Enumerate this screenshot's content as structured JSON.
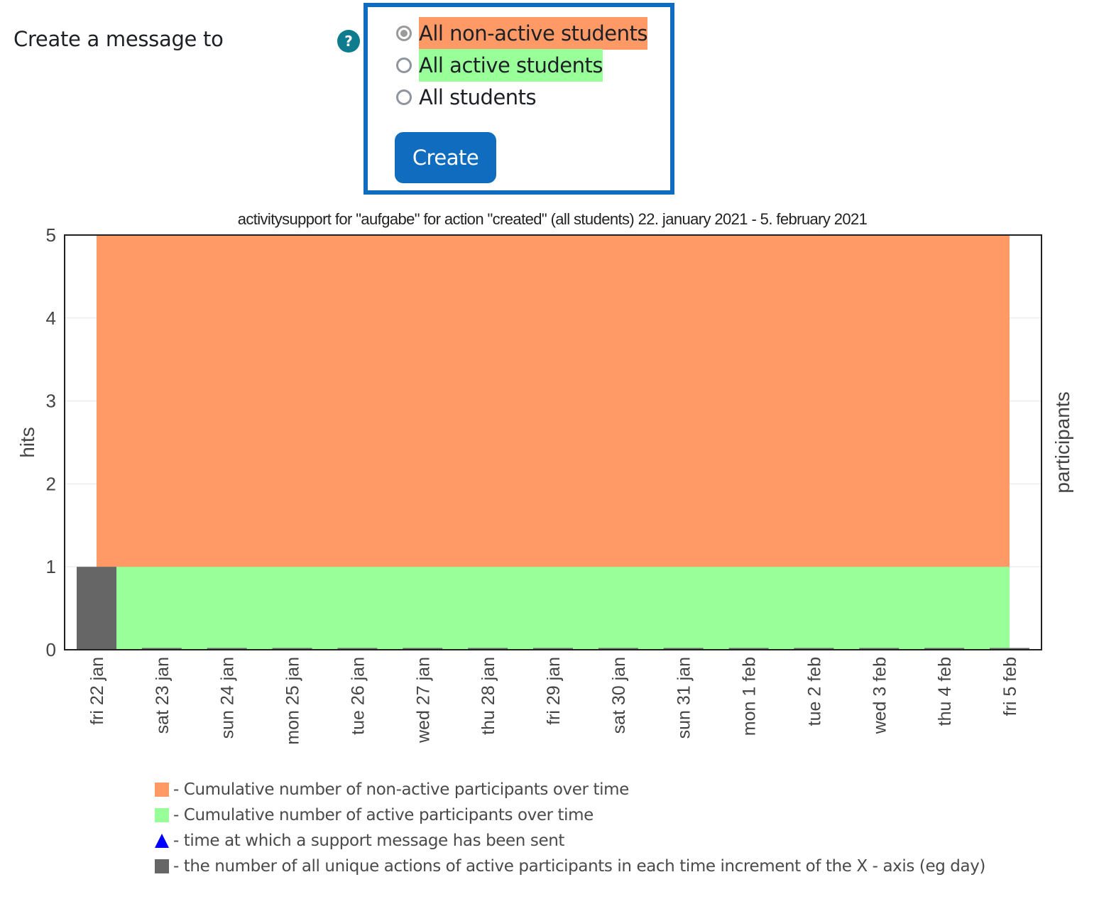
{
  "form": {
    "label": "Create a message to",
    "help_icon": "question-circle-icon",
    "options": [
      {
        "label": "All non-active students",
        "checked": true,
        "highlight": "#ff9966"
      },
      {
        "label": "All active students",
        "checked": false,
        "highlight": "#99ff99"
      },
      {
        "label": "All students",
        "checked": false,
        "highlight": null
      }
    ],
    "create_label": "Create",
    "accent": "#0f6cbf"
  },
  "chart_data": {
    "type": "area",
    "title": "activitysupport for \"aufgabe\" for action \"created\"  (all students) 22. january 2021 - 5. february 2021",
    "xlabel": "",
    "ylabel": "hits",
    "ylabel_right": "participants",
    "ylim": [
      0,
      5
    ],
    "yticks": [
      0,
      1,
      2,
      3,
      4,
      5
    ],
    "grid": true,
    "categories": [
      "fri 22 jan",
      "sat 23 jan",
      "sun 24 jan",
      "mon 25 jan",
      "tue 26 jan",
      "wed 27 jan",
      "thu 28 jan",
      "fri 29 jan",
      "sat 30 jan",
      "sun 31 jan",
      "mon 1 feb",
      "tue 2 feb",
      "wed 3 feb",
      "thu 4 feb",
      "fri 5 feb"
    ],
    "series": [
      {
        "name": "Cumulative number of non-active participants over time",
        "type": "area",
        "color": "#ff9966",
        "values": [
          5,
          5,
          5,
          5,
          5,
          5,
          5,
          5,
          5,
          5,
          5,
          5,
          5,
          5,
          5
        ]
      },
      {
        "name": "Cumulative number of active participants over time",
        "type": "area",
        "color": "#99ff99",
        "values": [
          1,
          1,
          1,
          1,
          1,
          1,
          1,
          1,
          1,
          1,
          1,
          1,
          1,
          1,
          1
        ]
      },
      {
        "name": "the number of all unique actions of active participants in each time increment of the X - axis (eg day)",
        "type": "bar",
        "color": "#666666",
        "values": [
          1,
          0,
          0,
          0,
          0,
          0,
          0,
          0,
          0,
          0,
          0,
          0,
          0,
          0,
          0
        ]
      }
    ],
    "markers": [],
    "legend": [
      {
        "symbol": "square",
        "color": "#ff9966",
        "text": "- Cumulative number of non-active participants over time"
      },
      {
        "symbol": "square",
        "color": "#99ff99",
        "text": "- Cumulative number of active participants over time"
      },
      {
        "symbol": "triangle",
        "color": "#0000ff",
        "text": "- time at which a support message has been sent"
      },
      {
        "symbol": "square",
        "color": "#666666",
        "text": "- the number of all unique actions of active participants in each time increment of the X - axis (eg day)"
      }
    ],
    "legend_position": "bottom-left"
  }
}
